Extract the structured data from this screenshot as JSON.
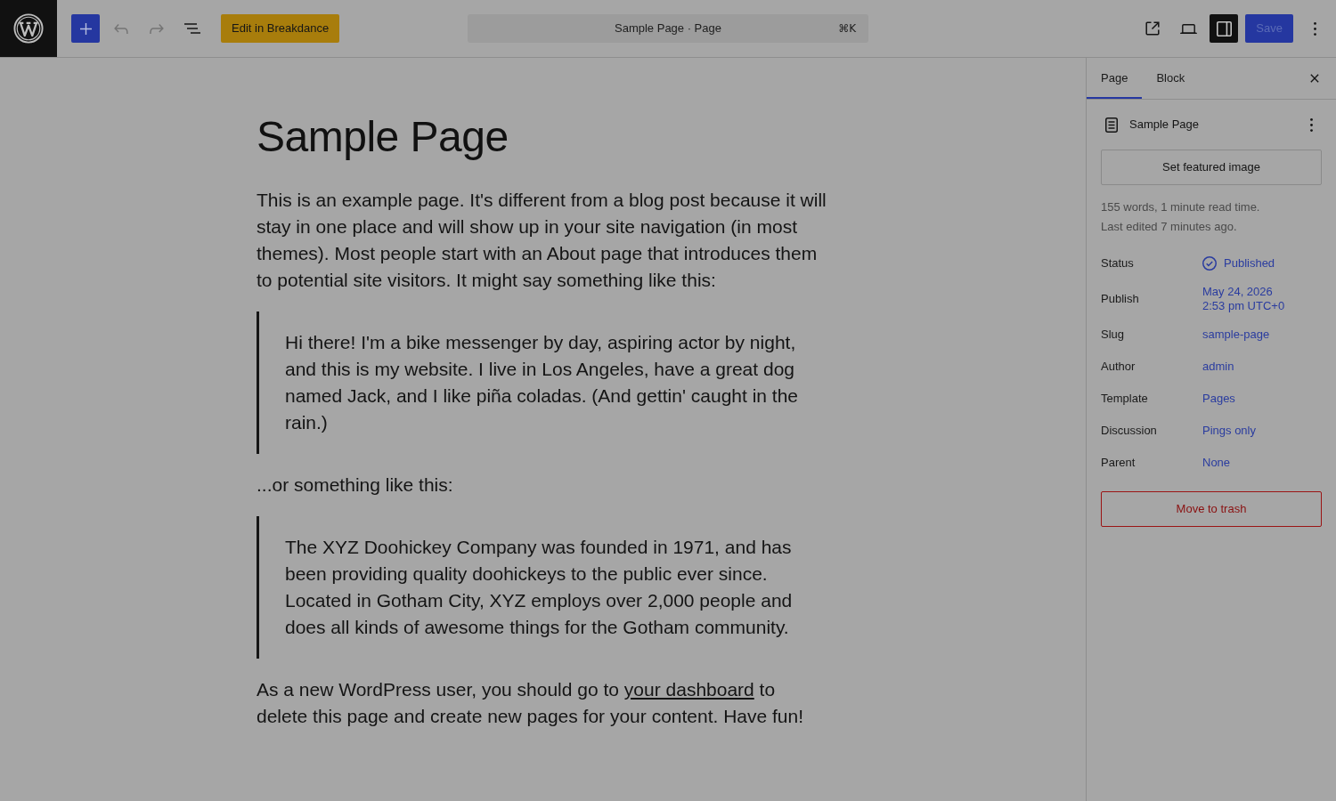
{
  "header": {
    "history": [
      {
        "kind": "undo",
        "disabled": true
      },
      {
        "kind": "redo",
        "disabled": true
      }
    ],
    "breakdance_button": "Edit in Breakdance",
    "command_bar": {
      "title": "Sample Page · Page",
      "shortcut": "⌘K"
    },
    "sidebar_toggle": {
      "pressed": true
    },
    "save_button": {
      "label": "Save",
      "disabled": true
    }
  },
  "editor": {
    "title": "Sample Page",
    "blocks": [
      {
        "kind": "paragraph",
        "text": "This is an example page. It's different from a blog post because it will stay in one place and will show up in your site navigation (in most themes). Most people start with an About page that introduces them to potential site visitors. It might say something like this:"
      },
      {
        "kind": "quote",
        "text": "Hi there! I'm a bike messenger by day, aspiring actor by night, and this is my website. I live in Los Angeles, have a great dog named Jack, and I like piña coladas. (And gettin' caught in the rain.)"
      },
      {
        "kind": "paragraph",
        "text": "...or something like this:"
      },
      {
        "kind": "quote",
        "text": "The XYZ Doohickey Company was founded in 1971, and has been providing quality doohickeys to the public ever since. Located in Gotham City, XYZ employs over 2,000 people and does all kinds of awesome things for the Gotham community."
      },
      {
        "kind": "paragraph",
        "text": "As a new WordPress user, you should go to ",
        "link": "your dashboard",
        "text_after": " to delete this page and create new pages for your content. Have fun!"
      }
    ]
  },
  "sidebar": {
    "tabs": [
      {
        "label": "Page",
        "selected": true
      },
      {
        "label": "Block",
        "selected": false
      }
    ],
    "page_title": "Sample Page",
    "featured_image_button": "Set featured image",
    "stats": [
      "155 words, 1 minute read time.",
      "Last edited 7 minutes ago."
    ],
    "fields": [
      {
        "label": "Status",
        "value": "Published",
        "kind": "status"
      },
      {
        "label": "Publish",
        "value": "May 24, 2026 2:53 pm UTC+0",
        "kind": "date"
      },
      {
        "label": "Slug",
        "value": "sample-page",
        "kind": "text"
      },
      {
        "label": "Author",
        "value": "admin",
        "kind": "text"
      },
      {
        "label": "Template",
        "value": "Pages",
        "kind": "text"
      },
      {
        "label": "Discussion",
        "value": "Pings only",
        "kind": "text"
      },
      {
        "label": "Parent",
        "value": "None",
        "kind": "text"
      }
    ],
    "trash_button": "Move to trash"
  }
}
